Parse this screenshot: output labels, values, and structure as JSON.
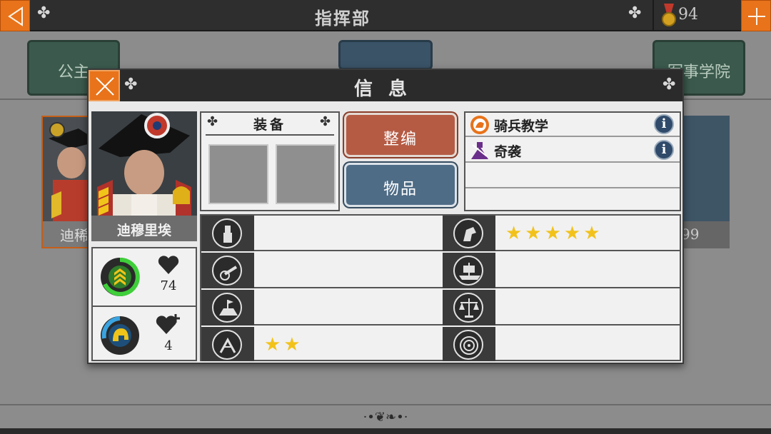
{
  "topbar": {
    "title": "指挥部",
    "medal_count": "94"
  },
  "background": {
    "card_left": "公主",
    "card_right": "军事学院",
    "hero_partial_name": "迪稀",
    "slot_number": "99"
  },
  "modal": {
    "title": "信息",
    "hero_name": "迪穆里埃",
    "stats": {
      "health": "74",
      "heal": "4"
    },
    "equipment_title": "装备",
    "buttons": {
      "reorganize": "整编",
      "items": "物品"
    },
    "skills": [
      {
        "label": "骑兵教学",
        "icon": "cavalry-badge-icon"
      },
      {
        "label": "奇袭",
        "icon": "ambush-icon"
      }
    ],
    "attributes_left": [
      {
        "icon": "infantry-icon",
        "stars": ""
      },
      {
        "icon": "artillery-icon",
        "stars": ""
      },
      {
        "icon": "fortification-icon",
        "stars": ""
      },
      {
        "icon": "engineer-icon",
        "stars": "★★"
      }
    ],
    "attributes_right": [
      {
        "icon": "cavalry-icon",
        "stars": "★★★★★"
      },
      {
        "icon": "navy-icon",
        "stars": ""
      },
      {
        "icon": "diplomacy-icon",
        "stars": ""
      },
      {
        "icon": "target-icon",
        "stars": ""
      }
    ]
  },
  "colors": {
    "accent_orange": "#e8731a",
    "star_gold": "#f2c21b",
    "red_button": "#b55b44",
    "blue_button": "#4f6c86"
  }
}
